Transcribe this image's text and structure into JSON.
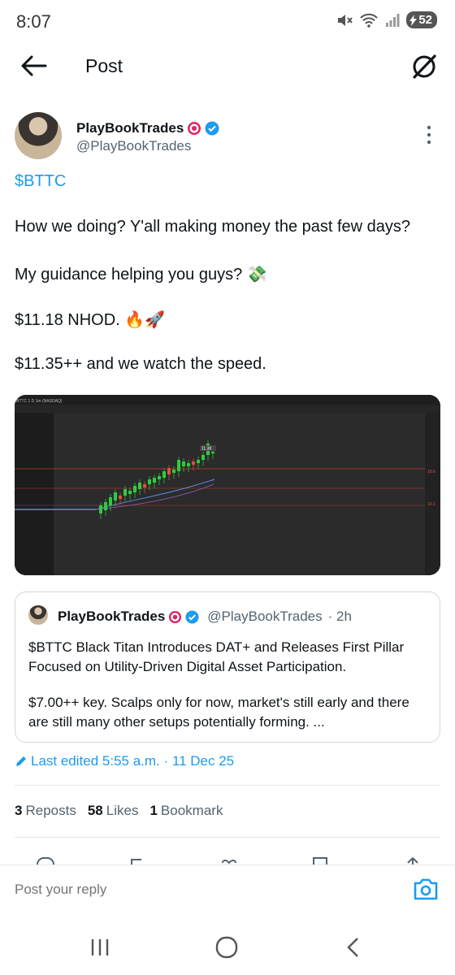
{
  "status": {
    "time": "8:07",
    "battery": "52"
  },
  "header": {
    "title": "Post"
  },
  "author": {
    "name": "PlayBookTrades",
    "handle": "@PlayBookTrades"
  },
  "tweet": {
    "cashtag": "$BTTC",
    "lines": [
      "How we doing? Y'all making money the past few days?",
      "My guidance helping you guys? 💸",
      "$11.18 NHOD. 🔥🚀",
      "$11.35++ and we watch the speed."
    ]
  },
  "chart_data": {
    "type": "candlestick",
    "ticker_label": "BTTC 1 D 1m (NASDAQ)",
    "price_marker": "11.38",
    "right_labels": [
      "10.6",
      "10.1"
    ]
  },
  "quote": {
    "name": "PlayBookTrades",
    "handle": "@PlayBookTrades",
    "time": "· 2h",
    "line1": "$BTTC Black Titan Introduces DAT+ and Releases First Pillar",
    "line2": "Focused on Utility-Driven Digital Asset Participation.",
    "line3": "$7.00++ key. Scalps only for now, market's still early and there",
    "line4": "are still many other setups potentially forming. ..."
  },
  "edited": "Last edited 5:55 a.m. · 11 Dec 25",
  "stats": {
    "reposts_count": "3",
    "reposts_label": "Reposts",
    "likes_count": "58",
    "likes_label": "Likes",
    "bookmarks_count": "1",
    "bookmarks_label": "Bookmark"
  },
  "reply": {
    "placeholder": "Post your reply"
  },
  "colors": {
    "accent": "#1d9bf0",
    "text": "#0f1419",
    "muted": "#536471"
  }
}
